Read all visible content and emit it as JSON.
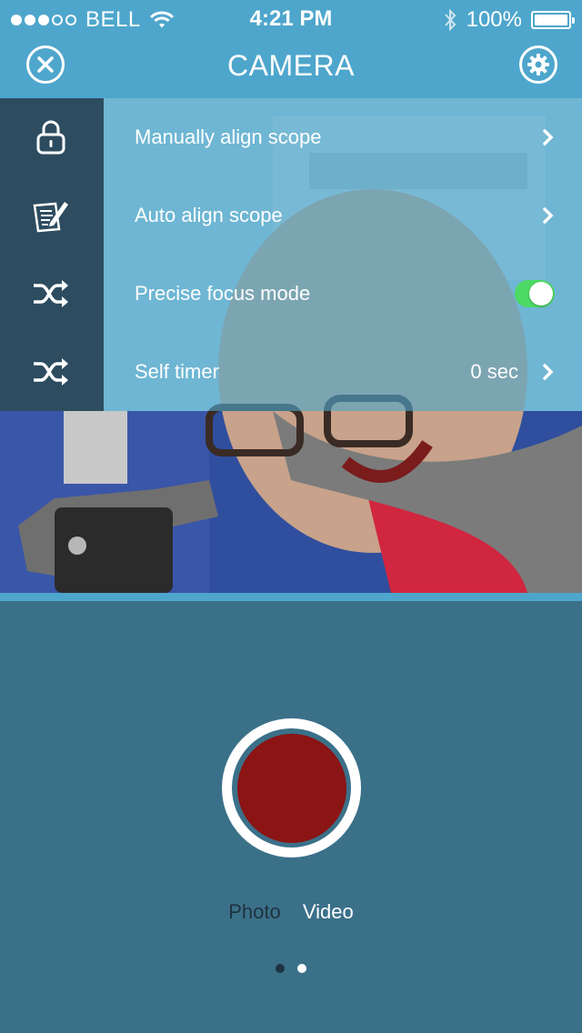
{
  "status_bar": {
    "carrier": "BELL",
    "signal_bars_filled": 3,
    "signal_bars_total": 5,
    "time": "4:21 PM",
    "battery": "100%"
  },
  "nav": {
    "title": "CAMERA",
    "close_icon": "close-circle-icon",
    "settings_icon": "gear-icon"
  },
  "menu": {
    "items": [
      {
        "icon": "lock-icon",
        "label": "Manually align scope",
        "type": "link"
      },
      {
        "icon": "edit-document-icon",
        "label": "Auto align scope",
        "type": "link"
      },
      {
        "icon": "shuffle-icon",
        "label": "Precise focus mode",
        "type": "toggle",
        "on": true
      },
      {
        "icon": "shuffle-icon",
        "label": "Self timer",
        "type": "link",
        "value": "0 sec"
      }
    ]
  },
  "capture": {
    "modes": [
      "Photo",
      "Video"
    ],
    "selected_mode": "Video",
    "page_count": 2,
    "current_page": 2
  },
  "colors": {
    "accent": "#4ea6cc",
    "panel": "#3b7089",
    "record": "#8b1414",
    "toggle_on": "#4cd964"
  }
}
